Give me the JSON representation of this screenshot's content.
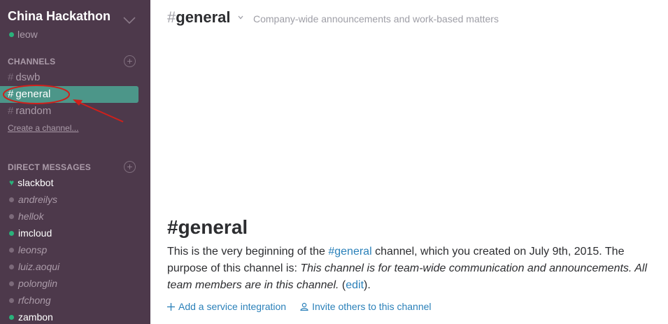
{
  "sidebar": {
    "team_name": "China Hackathon",
    "user_name": "leow",
    "channels_header": "CHANNELS",
    "channels": [
      {
        "name": "dswb"
      },
      {
        "name": "general"
      },
      {
        "name": "random"
      }
    ],
    "hash": "#",
    "create_channel": "Create a channel...",
    "dm_header": "DIRECT MESSAGES",
    "direct_messages": [
      {
        "name": "slackbot",
        "status": "bot"
      },
      {
        "name": "andreilys",
        "status": "away"
      },
      {
        "name": "hellok",
        "status": "away"
      },
      {
        "name": "imcloud",
        "status": "online"
      },
      {
        "name": "leonsp",
        "status": "away"
      },
      {
        "name": "luiz.aoqui",
        "status": "away"
      },
      {
        "name": "polonglin",
        "status": "away"
      },
      {
        "name": "rfchong",
        "status": "away"
      },
      {
        "name": "zambon",
        "status": "online"
      }
    ]
  },
  "header": {
    "hash": "#",
    "channel": "general",
    "purpose": "Company-wide announcements and work-based matters"
  },
  "intro": {
    "title": "#general",
    "p1": "This is the very beginning of the ",
    "channel_link": "#general",
    "p2": " channel, which you created on July 9th, 2015. The purpose of this channel is: ",
    "purpose_italic": "This channel is for team-wide communication and announcements. All team members are in this channel.",
    "p3": " (",
    "edit_link": "edit",
    "p4": ")."
  },
  "actions": {
    "add_integration": "Add a service integration",
    "invite": "Invite others to this channel"
  },
  "colors": {
    "sidebar_bg": "#4d394b",
    "active_channel": "#4c9689",
    "link": "#2a80b9",
    "annotation": "#d0201b"
  }
}
